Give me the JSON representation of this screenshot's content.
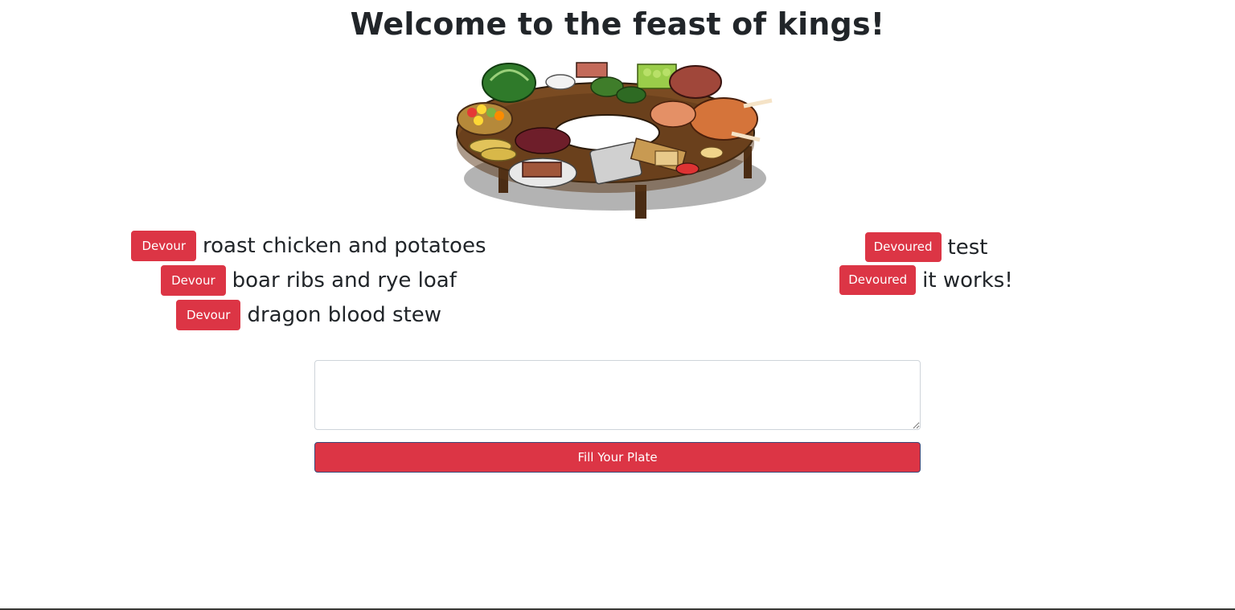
{
  "page": {
    "title": "Welcome to the feast of kings!"
  },
  "image": {
    "description_icon": "feast-table-image"
  },
  "undevoured": {
    "items": [
      {
        "button_label": "Devour",
        "name": "roast chicken and potatoes"
      },
      {
        "button_label": "Devour",
        "name": "boar ribs and rye loaf"
      },
      {
        "button_label": "Devour",
        "name": "dragon blood stew"
      }
    ]
  },
  "devoured": {
    "items": [
      {
        "button_label": "Devoured",
        "name": "test"
      },
      {
        "button_label": "Devoured",
        "name": "it works!"
      }
    ]
  },
  "form": {
    "textarea_value": "",
    "textarea_placeholder": "",
    "submit_label": "Fill Your Plate"
  },
  "colors": {
    "accent": "#dc3545",
    "text": "#212529",
    "border": "#ced4da"
  }
}
